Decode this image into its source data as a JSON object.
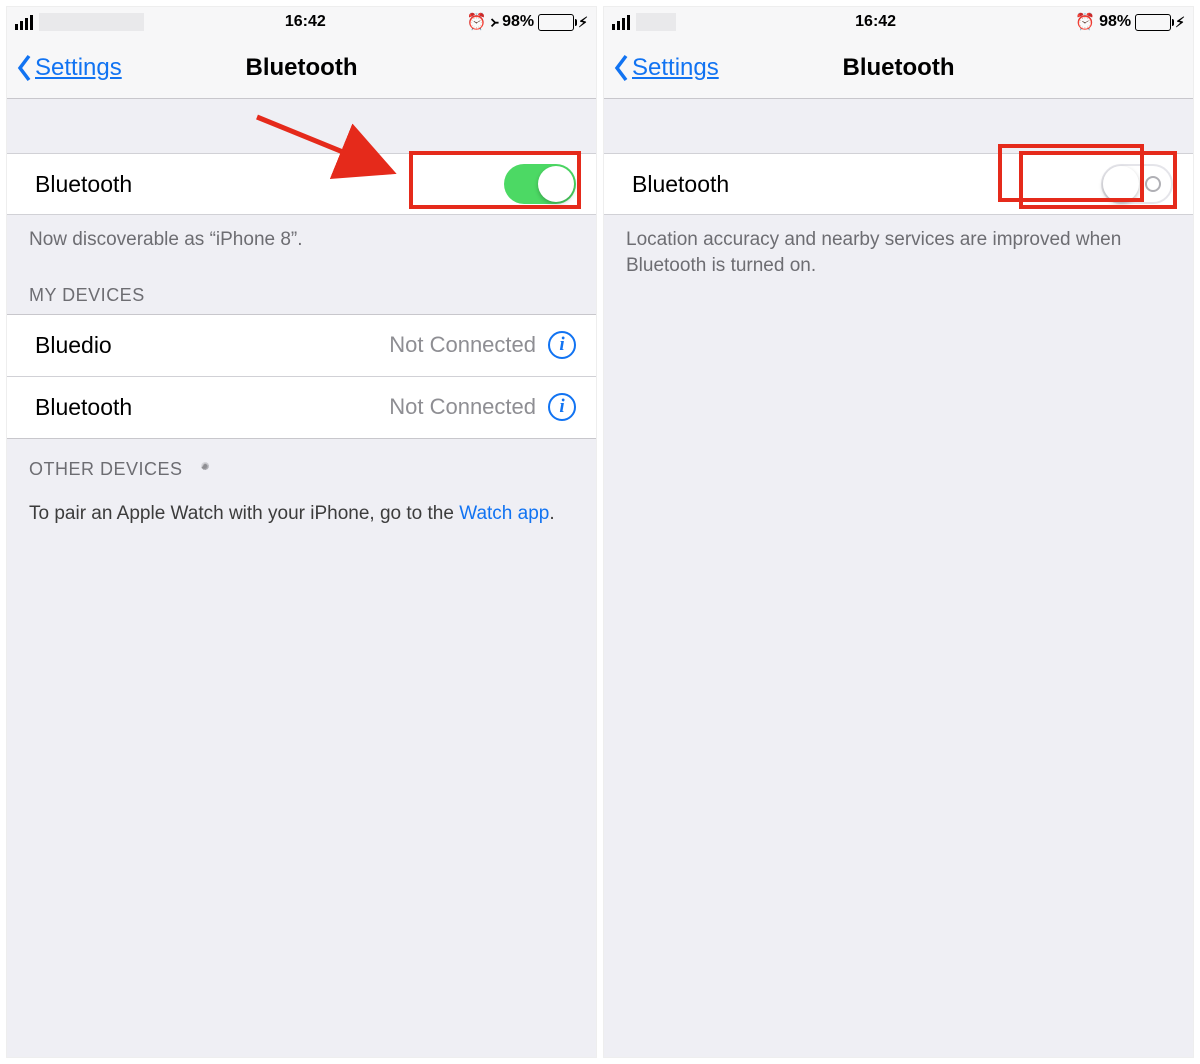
{
  "left": {
    "status": {
      "time": "16:42",
      "battery_pct": "98%"
    },
    "nav": {
      "back": "Settings",
      "title": "Bluetooth"
    },
    "bt_row": {
      "label": "Bluetooth",
      "on": true
    },
    "discoverable": "Now discoverable as “iPhone 8”.",
    "my_devices_header": "MY DEVICES",
    "devices": [
      {
        "name": "Bluedio",
        "status": "Not Connected"
      },
      {
        "name": "Bluetooth",
        "status": "Not Connected"
      }
    ],
    "other_devices_header": "OTHER DEVICES",
    "pair_text": "To pair an Apple Watch with your iPhone, go to the ",
    "pair_link": "Watch app",
    "pair_tail": "."
  },
  "right": {
    "status": {
      "time": "16:42",
      "battery_pct": "98%"
    },
    "nav": {
      "back": "Settings",
      "title": "Bluetooth"
    },
    "bt_row": {
      "label": "Bluetooth",
      "on": false
    },
    "off_note": "Location accuracy and nearby services are improved when Bluetooth is turned on."
  }
}
